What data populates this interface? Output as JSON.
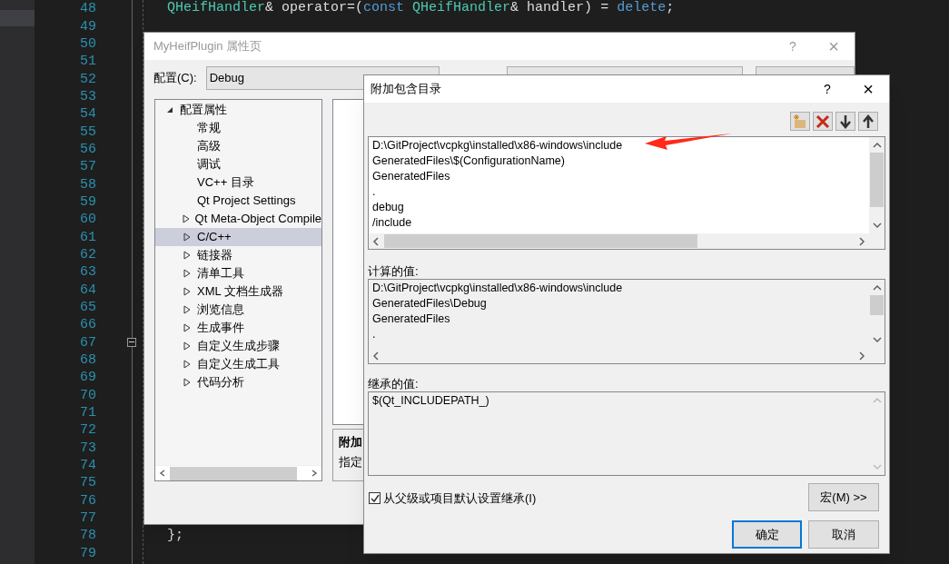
{
  "editor": {
    "lines": [
      {
        "number": "48",
        "code": [
          {
            "text": "QHeifHandler",
            "kind": "type"
          },
          {
            "text": "& operator=(",
            "kind": "plain"
          },
          {
            "text": "const",
            "kind": "keyword"
          },
          {
            "text": " QHeifHandler",
            "kind": "type"
          },
          {
            "text": "& handler) = ",
            "kind": "plain"
          },
          {
            "text": "delete",
            "kind": "keyword"
          },
          {
            "text": ";",
            "kind": "plain"
          }
        ]
      },
      {
        "number": "49"
      },
      {
        "number": "50"
      },
      {
        "number": "51"
      },
      {
        "number": "52"
      },
      {
        "number": "53"
      },
      {
        "number": "54"
      },
      {
        "number": "55"
      },
      {
        "number": "56"
      },
      {
        "number": "57"
      },
      {
        "number": "58"
      },
      {
        "number": "59"
      },
      {
        "number": "60"
      },
      {
        "number": "61"
      },
      {
        "number": "62"
      },
      {
        "number": "63"
      },
      {
        "number": "64"
      },
      {
        "number": "65"
      },
      {
        "number": "66"
      },
      {
        "number": "67",
        "fold_marker": true
      },
      {
        "number": "68"
      },
      {
        "number": "69"
      },
      {
        "number": "70"
      },
      {
        "number": "71"
      },
      {
        "number": "72"
      },
      {
        "number": "73"
      },
      {
        "number": "74"
      },
      {
        "number": "75"
      },
      {
        "number": "76"
      },
      {
        "number": "77"
      },
      {
        "number": "78",
        "code": [
          {
            "text": "};",
            "kind": "plain"
          }
        ]
      },
      {
        "number": "79"
      }
    ]
  },
  "property_page": {
    "title": "MyHeifPlugin 属性页",
    "help": "?",
    "close": "×",
    "config_label": "配置(C):",
    "config_value": "Debug",
    "tree": [
      {
        "label": "配置属性",
        "kind": "group",
        "expanded": true,
        "selected": false,
        "children": [
          {
            "label": "常规",
            "kind": "page",
            "selected": false
          },
          {
            "label": "高级",
            "kind": "page",
            "selected": false
          },
          {
            "label": "调试",
            "kind": "page",
            "selected": false
          },
          {
            "label": "VC++ 目录",
            "kind": "page",
            "selected": false
          },
          {
            "label": "Qt Project Settings",
            "kind": "page",
            "selected": false
          },
          {
            "label": "Qt Meta-Object Compile",
            "kind": "group",
            "expanded": false,
            "selected": false
          },
          {
            "label": "C/C++",
            "kind": "group",
            "expanded": false,
            "selected": true
          },
          {
            "label": "链接器",
            "kind": "group",
            "expanded": false,
            "selected": false
          },
          {
            "label": "清单工具",
            "kind": "group",
            "expanded": false,
            "selected": false
          },
          {
            "label": "XML 文档生成器",
            "kind": "group",
            "expanded": false,
            "selected": false
          },
          {
            "label": "浏览信息",
            "kind": "group",
            "expanded": false,
            "selected": false
          },
          {
            "label": "生成事件",
            "kind": "group",
            "expanded": false,
            "selected": false
          },
          {
            "label": "自定义生成步骤",
            "kind": "group",
            "expanded": false,
            "selected": false
          },
          {
            "label": "自定义生成工具",
            "kind": "group",
            "expanded": false,
            "selected": false
          },
          {
            "label": "代码分析",
            "kind": "group",
            "expanded": false,
            "selected": false
          }
        ]
      }
    ],
    "description": {
      "title": "附加",
      "text": "指定"
    }
  },
  "include_dialog": {
    "title": "附加包含目录",
    "help": "?",
    "close": "×",
    "entries": [
      "D:\\GitProject\\vcpkg\\installed\\x86-windows\\include",
      "GeneratedFiles\\$(ConfigurationName)",
      "GeneratedFiles",
      ".",
      "debug",
      "/include"
    ],
    "computed_label": "计算的值:",
    "computed": [
      "D:\\GitProject\\vcpkg\\installed\\x86-windows\\include",
      "GeneratedFiles\\Debug",
      "GeneratedFiles",
      "."
    ],
    "inherited_label": "继承的值:",
    "inherited": [
      "$(Qt_INCLUDEPATH_)"
    ],
    "inherit": {
      "label": "从父级或项目默认设置继承(I)",
      "checked": true
    },
    "macros_button": "宏(M) >>",
    "ok_button": "确定",
    "cancel_button": "取消"
  }
}
